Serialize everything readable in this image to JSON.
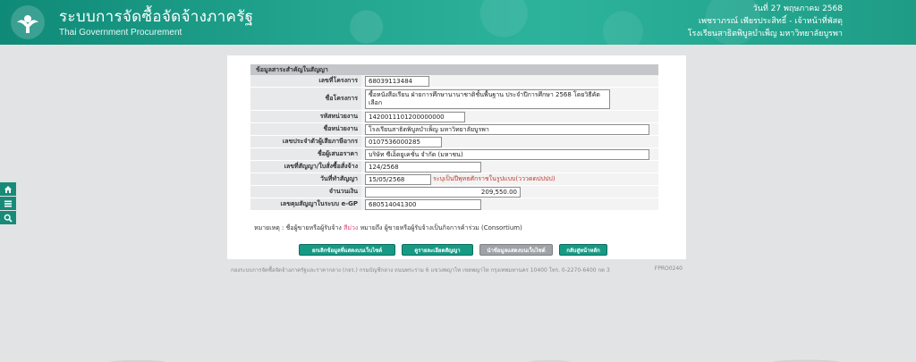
{
  "header": {
    "title": "ระบบการจัดซื้อจัดจ้างภาครัฐ",
    "subtitle": "Thai Government Procurement",
    "date": "วันที่ 27 พฤษภาคม 2568",
    "user_name": "เพชราภรณ์ เพียรประสิทธิ์ - เจ้าหน้าที่พัสดุ",
    "org": "โรงเรียนสาธิตพิบูลบำเพ็ญ มหาวิทยาลัยบูรพา"
  },
  "side_icons": [
    "home-icon",
    "menu-icon",
    "search-icon"
  ],
  "form": {
    "section_title": "ข้อมูลสาระสำคัญในสัญญา",
    "rows": [
      {
        "label": "เลขที่โครงการ",
        "value": "68039113484"
      },
      {
        "label": "ชื่อโครงการ",
        "value": "ซื้อหนังสือเรียน ฝ่ายการศึกษานานาชาติชั้นพื้นฐาน ประจำปีการศึกษา 2568 โดยวิธีคัดเลือก"
      },
      {
        "label": "รหัสหน่วยงาน",
        "value": "1420011101200000000"
      },
      {
        "label": "ชื่อหน่วยงาน",
        "value": "โรงเรียนสาธิตพิบูลบำเพ็ญ  มหาวิทยาลัยบูรพา"
      },
      {
        "label": "เลขประจำตัวผู้เสียภาษีอากร",
        "value": "0107536000285"
      },
      {
        "label": "ชื่อผู้เสนอราคา",
        "value": "บริษัท ซีเอ็ดยูเคชั่น จำกัด (มหาชน)"
      },
      {
        "label": "เลขที่สัญญา/ใบสั่งซื้อสั่งจ้าง",
        "value": "124/2568"
      },
      {
        "label": "วันที่ทำสัญญา",
        "value": "15/05/2568",
        "note": "ระบุเป็นปีพุทธศักราชในรูปแบบ(วววดดปปปป)"
      },
      {
        "label": "จำนวนเงิน",
        "value": "209,550.00"
      },
      {
        "label": "เลขคุมสัญญาในระบบ e-GP",
        "value": "680514041300"
      }
    ]
  },
  "remark": {
    "prefix": "หมายเหตุ : ชื่อผู้ขายหรือผู้รับจ้าง",
    "highlight": "สีม่วง",
    "suffix": "หมายถึง ผู้ขายหรือผู้รับจ้างเป็นกิจการค้าร่วม (Consortium)"
  },
  "buttons": [
    {
      "label": "ยกเลิกข้อมูลที่แสดงบนเว็บไซต์",
      "style": "green"
    },
    {
      "label": "ดูรายละเอียดสัญญา",
      "style": "green"
    },
    {
      "label": "นำข้อมูลแสดงบนเว็บไซต์",
      "style": "gray"
    },
    {
      "label": "กลับสู่หน้าหลัก",
      "style": "green"
    }
  ],
  "footer": {
    "text": "กองระบบการจัดซื้อจัดจ้างภาครัฐและราคากลาง (กจร.) กรมบัญชีกลาง ถนนพระราม 6 แขวงพญาไท เขตพญาไท กรุงเทพมหานคร 10400 โทร. 0-2270-6400 กด 3",
    "code": "FPRO0240"
  },
  "colors": {
    "header": "#1e9c86",
    "button_green": "#179a84",
    "button_gray": "#9fa3a7",
    "note_red": "#c0392b",
    "remark_purple": "#e0457b"
  }
}
